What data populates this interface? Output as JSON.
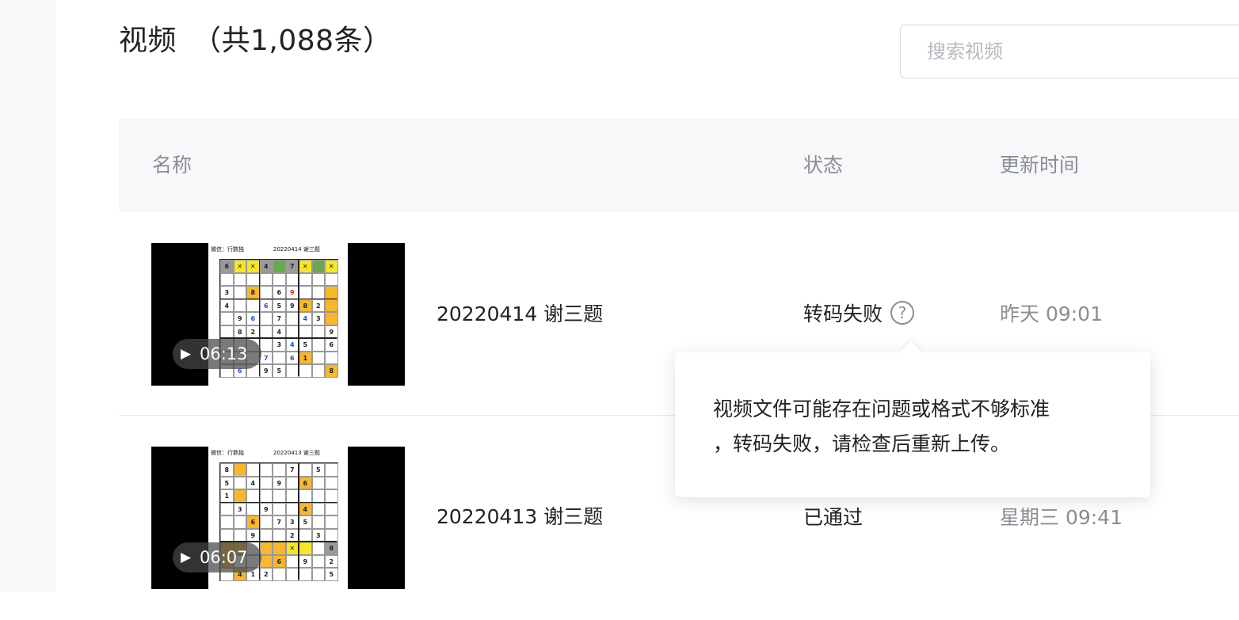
{
  "page": {
    "title": "视频",
    "count": "（共1,088条）",
    "search_placeholder": "搜索视频"
  },
  "table": {
    "columns": {
      "name": "名称",
      "status": "状态",
      "updated": "更新时间"
    },
    "rows": [
      {
        "title": "20220414 谢三题",
        "duration": "06:13",
        "status": "转码失败",
        "help_glyph": "?",
        "time": "昨天 09:01",
        "thumb": {
          "source": "微信：行数独",
          "date": "20220414 谢三题"
        }
      },
      {
        "title": "20220413 谢三题",
        "duration": "06:07",
        "status": "已通过",
        "time": "星期三 09:41",
        "thumb": {
          "source": "微信：行数独",
          "date": "20220413 谢三题"
        }
      }
    ]
  },
  "tooltip": {
    "line1": "视频文件可能存在问题或格式不够标准",
    "line2": "，转码失败，请检查后重新上传。"
  },
  "icons": {
    "play": "play-icon",
    "help": "question-circle-icon",
    "search": "search-input"
  },
  "colors": {
    "header_bg": "#f7f8fa",
    "muted_text": "#8a8d93",
    "sudoku_highlight": "#f6b731",
    "sudoku_yellow": "#f5e62b",
    "sudoku_green": "#6aa84f"
  }
}
